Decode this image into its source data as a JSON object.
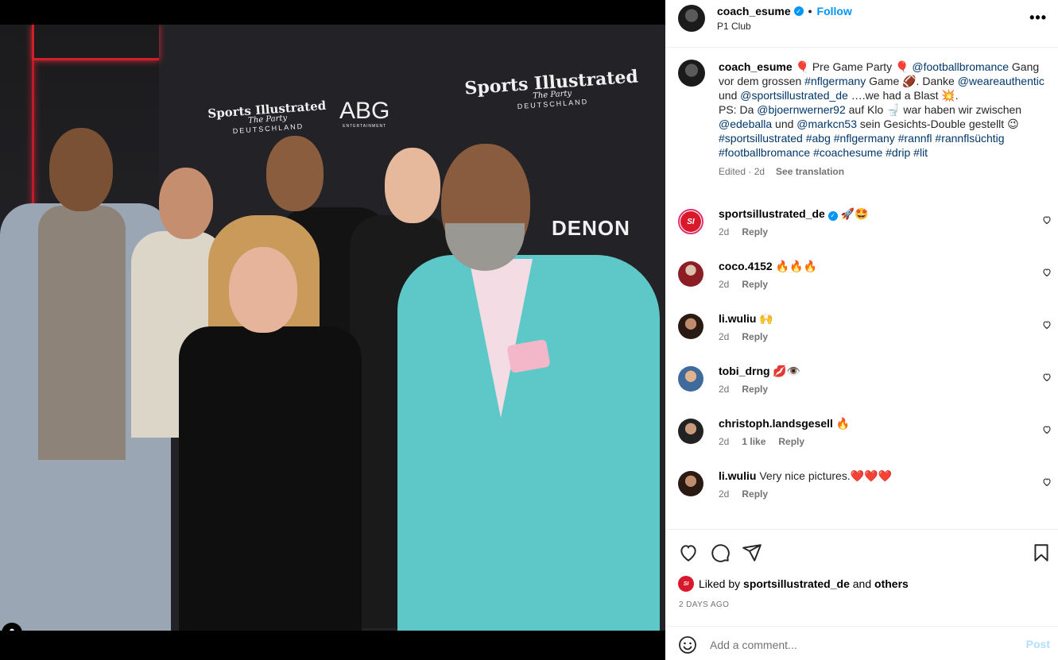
{
  "header": {
    "username": "coach_esume",
    "separator": "•",
    "follow_label": "Follow",
    "location": "P1 Club",
    "more_label": "•••"
  },
  "photo": {
    "brands": {
      "si_title": "Sports Illustrated",
      "si_sub": "The Party",
      "si_country": "DEUTSCHLAND",
      "abg": "ABG",
      "abg_sub": "ENTERTAINMENT",
      "denon": "DENON"
    }
  },
  "caption": {
    "username": "coach_esume",
    "line_parts": [
      " 🎈 Pre Game Party 🎈 ",
      "@footballbromance",
      " Gang vor dem grossen ",
      "#nflgermany",
      " Game 🏈. Danke ",
      "@weareauthentic",
      " und ",
      "@sportsillustrated_de",
      " ….we had a Blast 💥.",
      "PS: Da ",
      "@bjoernwerner92",
      " auf Klo 🚽 war haben wir zwischen ",
      "@edeballa",
      " und ",
      "@markcn53",
      " sein Gesichts-Double gestellt 😉 ",
      "#sportsillustrated",
      "#abg",
      "#nflgermany",
      "#rannfl",
      "#rannflsüchtig",
      "#footballbromance",
      "#coachesume",
      "#drip",
      "#lit"
    ],
    "meta_time": "Edited · 2d",
    "see_translation": "See translation"
  },
  "comments": [
    {
      "user": "sportsillustrated_de",
      "text": " 🚀🤩",
      "time": "2d",
      "likes": "",
      "reply": "Reply",
      "verified": true
    },
    {
      "user": "coco.4152",
      "text": " 🔥🔥🔥",
      "time": "2d",
      "likes": "",
      "reply": "Reply"
    },
    {
      "user": "li.wuliu",
      "text": " 🙌",
      "time": "2d",
      "likes": "",
      "reply": "Reply"
    },
    {
      "user": "tobi_drng",
      "text": " 💋👁️",
      "time": "2d",
      "likes": "",
      "reply": "Reply"
    },
    {
      "user": "christoph.landsgesell",
      "text": " 🔥",
      "time": "2d",
      "likes": "1 like",
      "reply": "Reply"
    },
    {
      "user": "li.wuliu",
      "text": " Very nice pictures.❤️❤️❤️",
      "time": "2d",
      "likes": "",
      "reply": "Reply"
    }
  ],
  "likes": {
    "prefix": "Liked by ",
    "user": "sportsillustrated_de",
    "mid": " and ",
    "others": "others",
    "si_badge": "SI"
  },
  "date_label": "2 DAYS AGO",
  "composer": {
    "placeholder": "Add a comment...",
    "post_label": "Post"
  },
  "colors": {
    "accent": "#0095f6",
    "link": "#00376b",
    "muted": "#737373",
    "post_disabled": "#b2dffc",
    "si_red": "#d7192b",
    "jacket": "#5ec8c8"
  },
  "icons": [
    "heart-icon",
    "comment-icon",
    "share-icon",
    "bookmark-icon",
    "emoji-icon",
    "user-tag-icon",
    "verified-icon",
    "more-icon"
  ]
}
